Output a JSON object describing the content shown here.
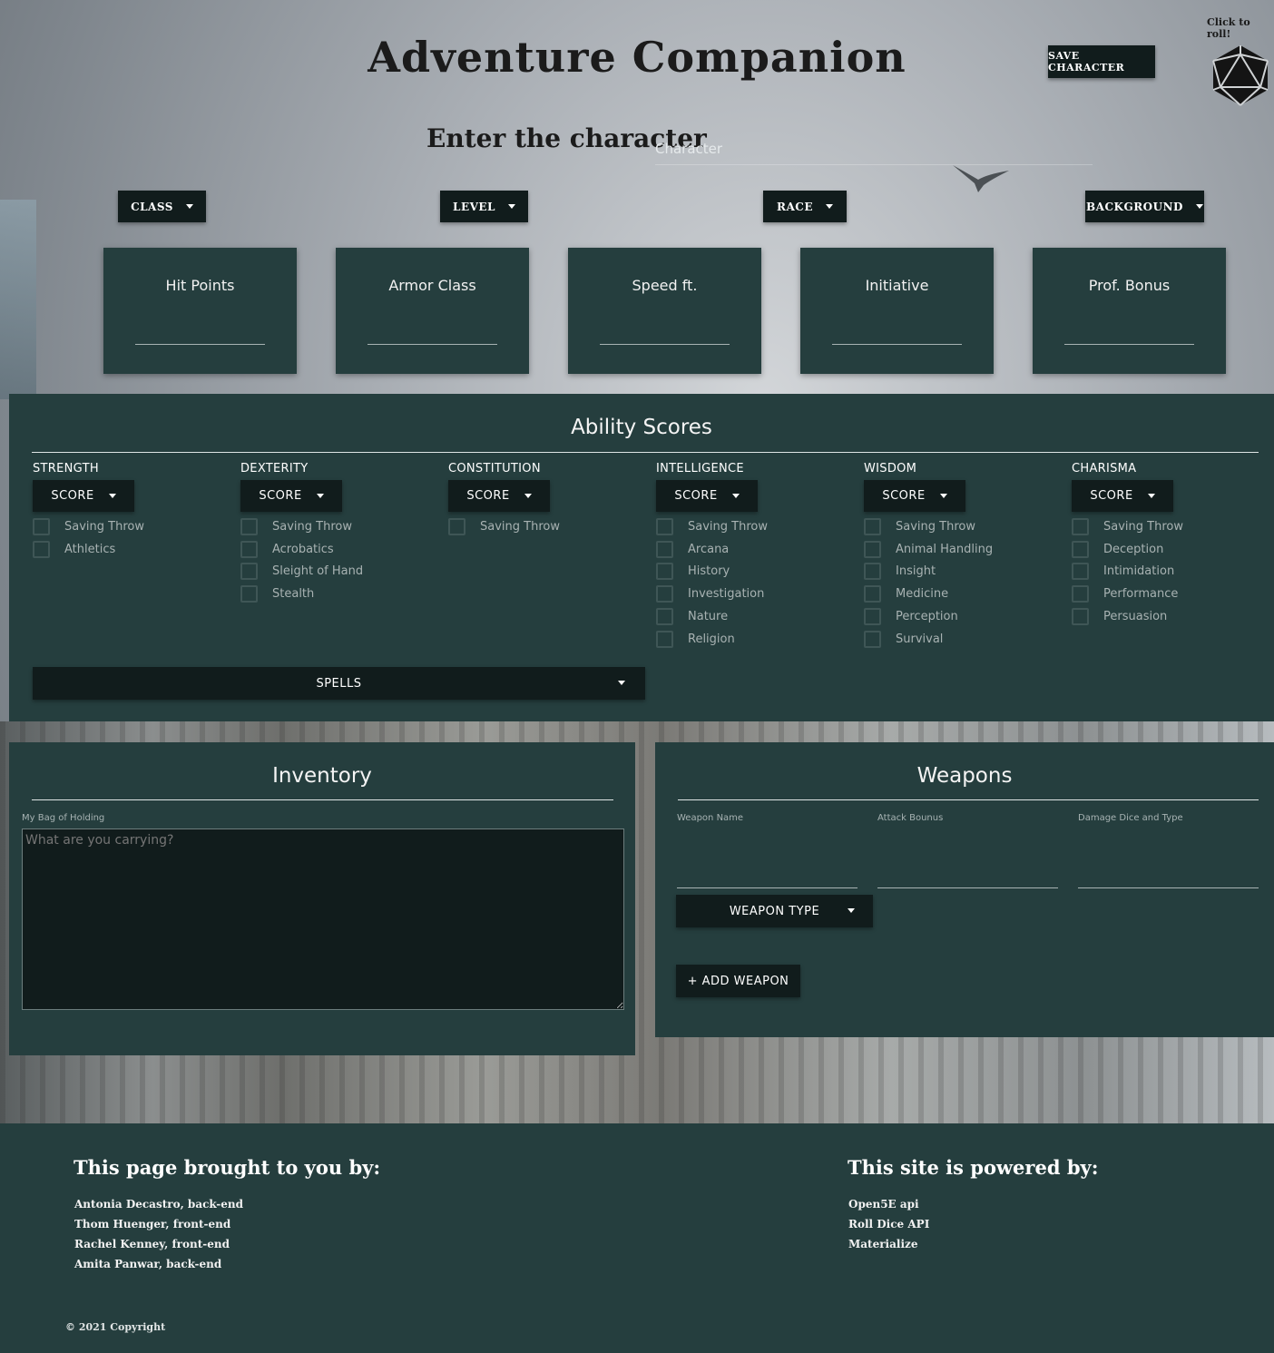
{
  "header": {
    "title": "Adventure Companion",
    "save_label": "SAVE CHARACTER",
    "roll_label": "Click to roll!",
    "enter_label": "Enter the character",
    "character_placeholder": "Character"
  },
  "dropdowns": {
    "class": "CLASS",
    "level": "LEVEL",
    "race": "RACE",
    "background": "BACKGROUND"
  },
  "stats": {
    "hit_points": "Hit Points",
    "armor_class": "Armor Class",
    "speed": "Speed ft.",
    "initiative": "Initiative",
    "prof_bonus": "Prof. Bonus"
  },
  "abilities": {
    "title": "Ability Scores",
    "score_label": "SCORE",
    "strength": {
      "name": "STRENGTH",
      "skills": [
        "Saving Throw",
        "Athletics"
      ]
    },
    "dexterity": {
      "name": "DEXTERITY",
      "skills": [
        "Saving Throw",
        "Acrobatics",
        "Sleight of Hand",
        "Stealth"
      ]
    },
    "constitution": {
      "name": "CONSTITUTION",
      "skills": [
        "Saving Throw"
      ]
    },
    "intelligence": {
      "name": "INTELLIGENCE",
      "skills": [
        "Saving Throw",
        "Arcana",
        "History",
        "Investigation",
        "Nature",
        "Religion"
      ]
    },
    "wisdom": {
      "name": "WISDOM",
      "skills": [
        "Saving Throw",
        "Animal Handling",
        "Insight",
        "Medicine",
        "Perception",
        "Survival"
      ]
    },
    "charisma": {
      "name": "CHARISMA",
      "skills": [
        "Saving Throw",
        "Deception",
        "Intimidation",
        "Performance",
        "Persuasion"
      ]
    },
    "spells_label": "SPELLS"
  },
  "inventory": {
    "title": "Inventory",
    "bag_label": "My Bag of Holding",
    "bag_placeholder": "What are you carrying?"
  },
  "weapons": {
    "title": "Weapons",
    "name_label": "Weapon Name",
    "attack_label": "Attack Bounus",
    "damage_label": "Damage Dice and Type",
    "type_label": "WEAPON TYPE",
    "add_label": "+ ADD WEAPON"
  },
  "footer": {
    "credits_title": "This page brought to you by:",
    "credits": [
      "Antonia Decastro, back-end",
      "Thom Huenger, front-end",
      "Rachel Kenney, front-end",
      "Amita Panwar, back-end"
    ],
    "powered_title": "This site is powered by:",
    "powered": [
      "Open5E api",
      "Roll Dice API",
      "Materialize"
    ],
    "copyright": "© 2021 Copyright"
  },
  "colors": {
    "panel": "#253e3e",
    "button": "#111c1c"
  }
}
